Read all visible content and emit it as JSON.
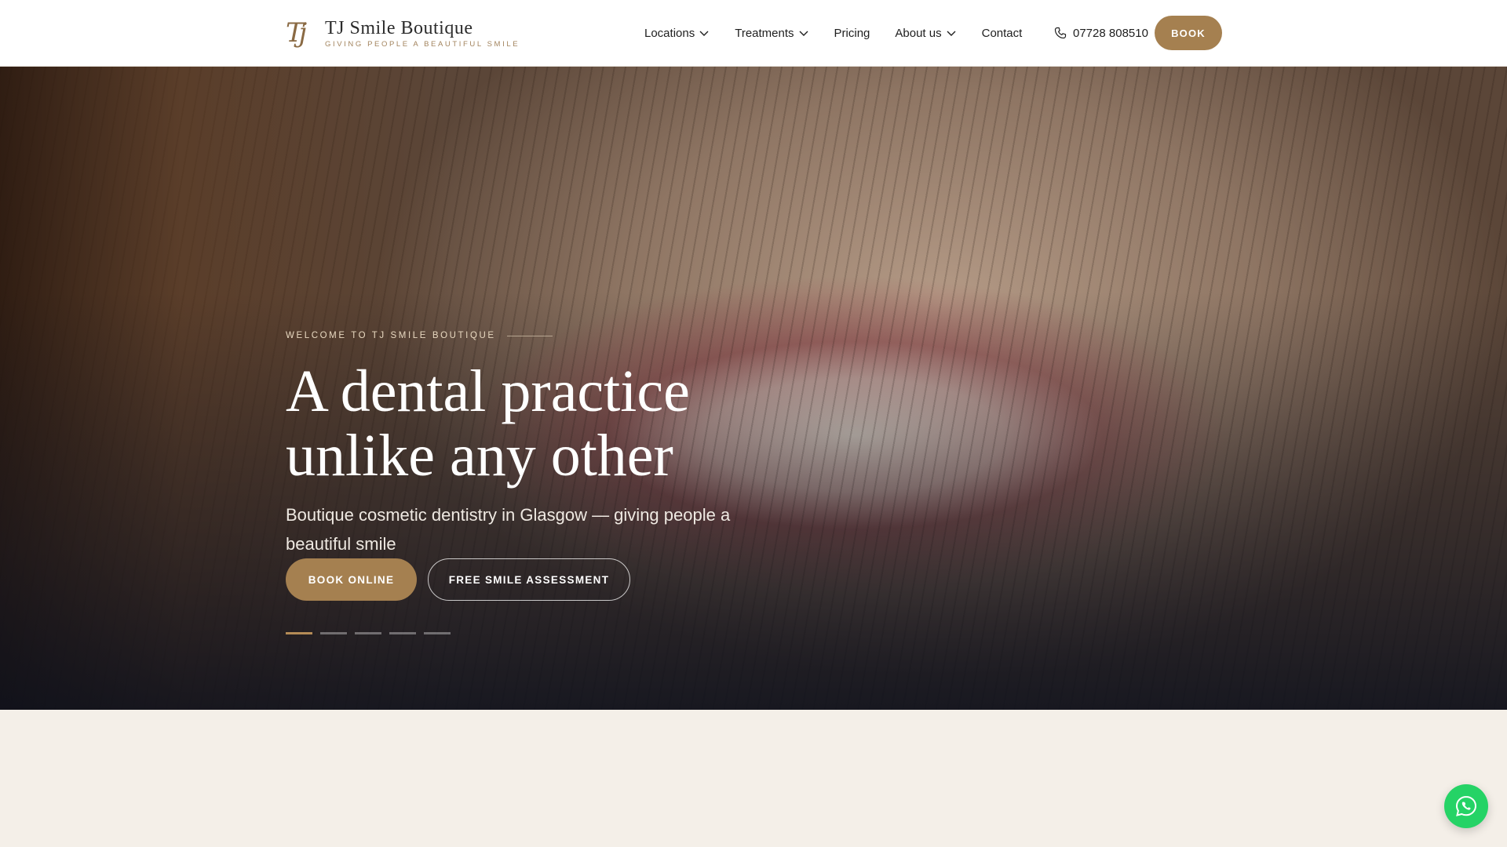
{
  "brand": {
    "mark": "Tj",
    "name": "TJ Smile Boutique",
    "tagline": "GIVING PEOPLE A BEAUTIFUL SMILE"
  },
  "nav": {
    "items": [
      {
        "label": "Locations",
        "dropdown": true
      },
      {
        "label": "Treatments",
        "dropdown": true
      },
      {
        "label": "Pricing",
        "dropdown": false
      },
      {
        "label": "About us",
        "dropdown": true
      },
      {
        "label": "Contact",
        "dropdown": false
      }
    ],
    "phone": "07728 808510",
    "book_label": "BOOK"
  },
  "hero": {
    "eyebrow": "WELCOME TO TJ SMILE BOUTIQUE",
    "headline_line1": "A dental practice",
    "headline_line2": "unlike any other",
    "subhead": "Boutique cosmetic dentistry in Glasgow — giving people a beautiful smile",
    "primary_cta": "BOOK ONLINE",
    "secondary_cta": "FREE SMILE ASSESSMENT",
    "slides": {
      "count": 5,
      "active_index": 0
    }
  },
  "colors": {
    "accent": "#a58050",
    "header_bg": "#ffffff",
    "section_bg": "#f4efe8",
    "whatsapp": "#25d366"
  },
  "icons": {
    "phone": "phone-icon",
    "dropdown": "chevron-down-icon",
    "whatsapp": "whatsapp-icon"
  }
}
